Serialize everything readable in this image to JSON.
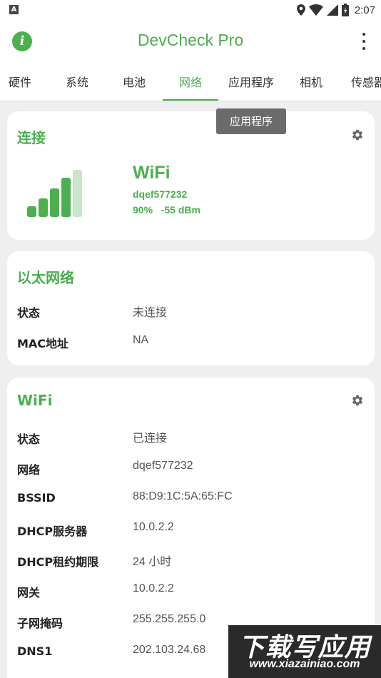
{
  "status_bar": {
    "notification_letter": "A",
    "time": "2:07"
  },
  "app_bar": {
    "title": "DevCheck Pro",
    "info_glyph": "i"
  },
  "tabs": [
    {
      "label": "硬件"
    },
    {
      "label": "系统"
    },
    {
      "label": "电池"
    },
    {
      "label": "网络",
      "active": true
    },
    {
      "label": "应用程序"
    },
    {
      "label": "相机"
    },
    {
      "label": "传感器"
    }
  ],
  "tooltip": "应用程序",
  "connection_card": {
    "title": "连接",
    "type": "WiFi",
    "ssid": "dqef577232",
    "signal_percent": "90%",
    "signal_dbm": "-55 dBm",
    "signal_level": 0.9
  },
  "ethernet_card": {
    "title": "以太网络",
    "rows": [
      {
        "label": "状态",
        "value": "未连接"
      },
      {
        "label": "MAC地址",
        "value": "NA"
      }
    ]
  },
  "wifi_card": {
    "title": "WiFi",
    "rows": [
      {
        "label": "状态",
        "value": "已连接"
      },
      {
        "label": "网络",
        "value": "dqef577232"
      },
      {
        "label": "BSSID",
        "value": "88:D9:1C:5A:65:FC"
      },
      {
        "label": "DHCP服务器",
        "value": "10.0.2.2"
      },
      {
        "label": "DHCP租约期限",
        "value": "24 小时"
      },
      {
        "label": "网关",
        "value": "10.0.2.2"
      },
      {
        "label": "子网掩码",
        "value": "255.255.255.0"
      },
      {
        "label": "DNS1",
        "value": "202.103.24.68"
      }
    ]
  },
  "watermark": {
    "line1": "下载写应用",
    "line2": "www.xiazainiao.com"
  },
  "colors": {
    "accent": "#4caf50",
    "accent_light": "#c8e6c9",
    "background": "#efefef",
    "card": "#ffffff",
    "tooltip": "#6b6b6b"
  },
  "icons": [
    "info-icon",
    "overflow-menu-icon",
    "location-icon",
    "wifi-icon",
    "cell-signal-icon",
    "battery-icon",
    "gear-icon",
    "signal-bars-icon"
  ]
}
